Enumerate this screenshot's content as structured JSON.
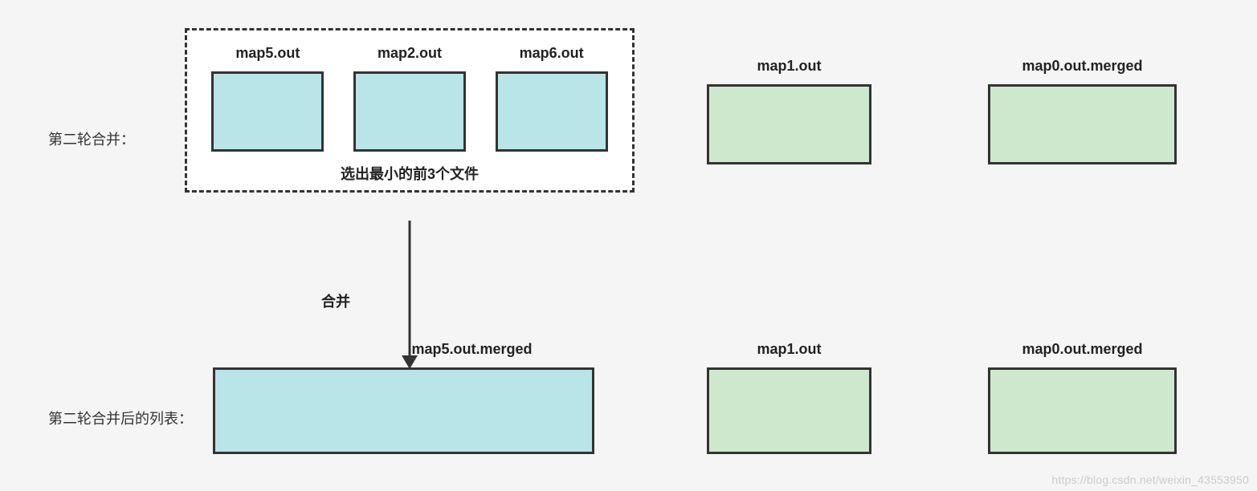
{
  "labels": {
    "row1": "第二轮合并：",
    "row2": "第二轮合并后的列表：",
    "groupCaption": "选出最小的前3个文件",
    "arrowLabel": "合并"
  },
  "topRow": {
    "groupFiles": [
      {
        "name": "map5.out"
      },
      {
        "name": "map2.out"
      },
      {
        "name": "map6.out"
      }
    ],
    "outside": [
      {
        "name": "map1.out"
      },
      {
        "name": "map0.out.merged"
      }
    ]
  },
  "bottomRow": {
    "merged": {
      "name": "map5.out.merged"
    },
    "others": [
      {
        "name": "map1.out"
      },
      {
        "name": "map0.out.merged"
      }
    ]
  },
  "watermark": "https://blog.csdn.net/weixin_43553950"
}
